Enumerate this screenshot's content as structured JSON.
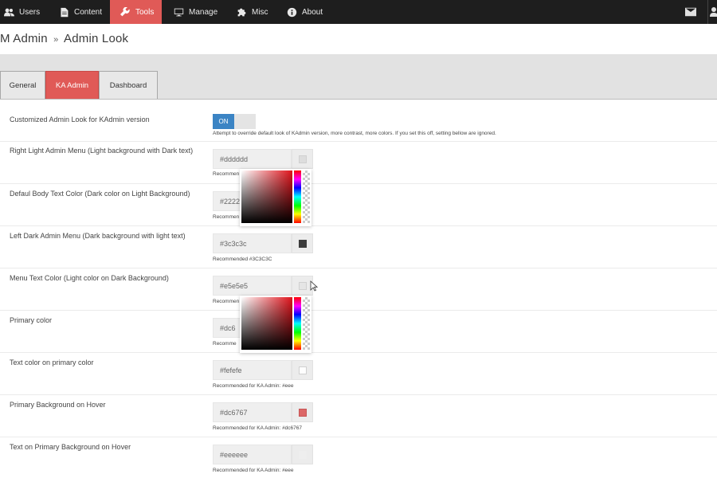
{
  "nav": {
    "items": [
      {
        "label": "Users",
        "icon": "users-icon"
      },
      {
        "label": "Content",
        "icon": "document-icon"
      },
      {
        "label": "Tools",
        "icon": "wrench-icon"
      },
      {
        "label": "Manage",
        "icon": "monitor-icon"
      },
      {
        "label": "Misc",
        "icon": "puzzle-icon"
      },
      {
        "label": "About",
        "icon": "info-icon"
      }
    ],
    "active": "Tools",
    "active_color": "#e05a57"
  },
  "title": {
    "part1": "M Admin",
    "sep": "»",
    "part2": "Admin Look"
  },
  "tabs": [
    {
      "label": "General"
    },
    {
      "label": "KA Admin"
    },
    {
      "label": "Dashboard"
    }
  ],
  "active_tab": "KA Admin",
  "rows": {
    "customized": {
      "label": "Customized Admin Look for KAdmin version",
      "toggle": "ON",
      "hint": "Attempt to override default look of KAdmin version, more contrast, more colors.   If you set this off, setting bellow are ignored."
    },
    "right_light_menu": {
      "label": "Right Light Admin Menu (Light background with Dark text)",
      "value": "#dddddd",
      "hint": "Recommen",
      "color": "#dddddd"
    },
    "body_text": {
      "label": "Defaul Body Text Color (Dark color on Light Background)",
      "value": "#2222",
      "hint": "Recommen",
      "color": "#222222"
    },
    "left_dark_menu": {
      "label": "Left Dark Admin Menu (Dark background with light text)",
      "value": "#3c3c3c",
      "hint": "Recommended #3C3C3C",
      "color": "#3c3c3c"
    },
    "menu_text": {
      "label": "Menu Text Color (Light color on Dark Background)",
      "value": "#e5e5e5",
      "hint": "Recommen",
      "color": "#e5e5e5"
    },
    "primary": {
      "label": "Primary color",
      "value": "#dc6",
      "hint": "Recomme",
      "color": "#dc6767"
    },
    "text_primary": {
      "label": "Text color on primary color",
      "value": "#fefefe",
      "hint": "Recommended for KA Admin: #eee",
      "color": "#fefefe"
    },
    "primary_hover": {
      "label": "Primary Background on Hover",
      "value": "#dc6767",
      "hint": "Recommended for KA Admin: #dc6767",
      "color": "#dc6767"
    },
    "text_primary_hover": {
      "label": "Text on Primary Background on Hover",
      "value": "#eeeeee",
      "hint": "Recommended for KA Admin: #eee",
      "color": "#eeeeee"
    }
  }
}
